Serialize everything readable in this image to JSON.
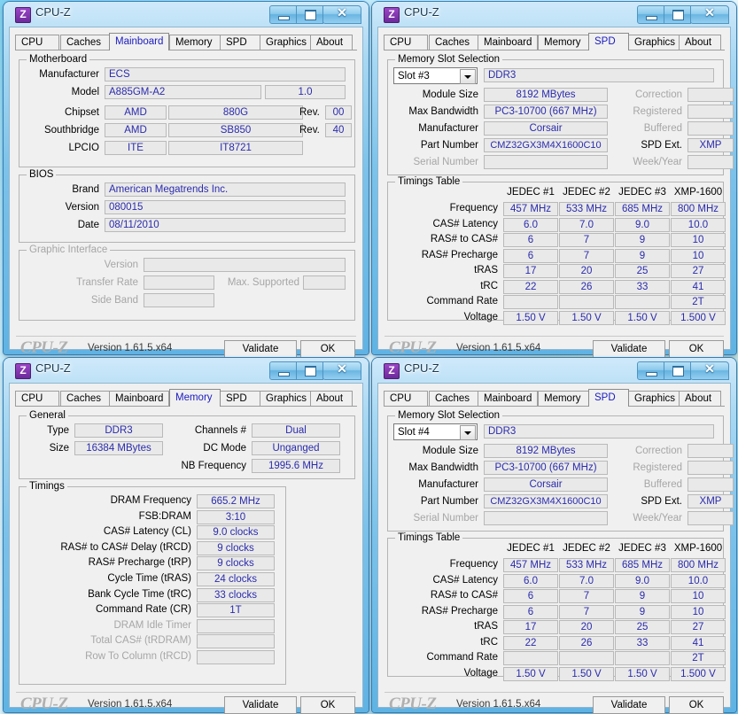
{
  "app": {
    "title": "CPU-Z",
    "icon": "cpuz-logo-icon",
    "logo_text": "CPU-Z",
    "version_text": "Version 1.61.5.x64",
    "validate_label": "Validate",
    "ok_label": "OK",
    "window_controls": {
      "minimize": "minimize-icon",
      "maximize": "maximize-icon",
      "close": "close-icon"
    }
  },
  "tabs": [
    "CPU",
    "Caches",
    "Mainboard",
    "Memory",
    "SPD",
    "Graphics",
    "About"
  ],
  "windows": {
    "mainboard": {
      "active_tab": "Mainboard",
      "motherboard": {
        "caption": "Motherboard",
        "manufacturer_label": "Manufacturer",
        "manufacturer_value": "ECS",
        "model_label": "Model",
        "model_value": "A885GM-A2",
        "model_rev_value": "1.0",
        "chipset_label": "Chipset",
        "chipset_vendor": "AMD",
        "chipset_model": "880G",
        "chipset_rev_label": "Rev.",
        "chipset_rev": "00",
        "southbridge_label": "Southbridge",
        "southbridge_vendor": "AMD",
        "southbridge_model": "SB850",
        "southbridge_rev_label": "Rev.",
        "southbridge_rev": "40",
        "lpcio_label": "LPCIO",
        "lpcio_vendor": "ITE",
        "lpcio_model": "IT8721"
      },
      "bios": {
        "caption": "BIOS",
        "brand_label": "Brand",
        "brand_value": "American Megatrends Inc.",
        "version_label": "Version",
        "version_value": "080015",
        "date_label": "Date",
        "date_value": "08/11/2010"
      },
      "graphic_interface": {
        "caption": "Graphic Interface",
        "version_label": "Version",
        "version_value": "",
        "transfer_rate_label": "Transfer Rate",
        "transfer_rate_value": "",
        "max_supported_label": "Max. Supported",
        "max_supported_value": "",
        "side_band_label": "Side Band",
        "side_band_value": ""
      }
    },
    "memory": {
      "active_tab": "Memory",
      "general": {
        "caption": "General",
        "type_label": "Type",
        "type_value": "DDR3",
        "size_label": "Size",
        "size_value": "16384 MBytes",
        "channels_label": "Channels #",
        "channels_value": "Dual",
        "dc_mode_label": "DC Mode",
        "dc_mode_value": "Unganged",
        "nb_frequency_label": "NB Frequency",
        "nb_frequency_value": "1995.6 MHz"
      },
      "timings": {
        "caption": "Timings",
        "rows": [
          {
            "label": "DRAM Frequency",
            "value": "665.2 MHz",
            "dim": false
          },
          {
            "label": "FSB:DRAM",
            "value": "3:10",
            "dim": false
          },
          {
            "label": "CAS# Latency (CL)",
            "value": "9.0 clocks",
            "dim": false
          },
          {
            "label": "RAS# to CAS# Delay (tRCD)",
            "value": "9 clocks",
            "dim": false
          },
          {
            "label": "RAS# Precharge (tRP)",
            "value": "9 clocks",
            "dim": false
          },
          {
            "label": "Cycle Time (tRAS)",
            "value": "24 clocks",
            "dim": false
          },
          {
            "label": "Bank Cycle Time (tRC)",
            "value": "33 clocks",
            "dim": false
          },
          {
            "label": "Command Rate (CR)",
            "value": "1T",
            "dim": false
          },
          {
            "label": "DRAM Idle Timer",
            "value": "",
            "dim": true
          },
          {
            "label": "Total CAS# (tRDRAM)",
            "value": "",
            "dim": true
          },
          {
            "label": "Row To Column (tRCD)",
            "value": "",
            "dim": true
          }
        ]
      }
    },
    "spd_slot3": {
      "active_tab": "SPD",
      "slot_selection": {
        "caption": "Memory Slot Selection",
        "slot_value": "Slot #3",
        "memory_type": "DDR3",
        "module_size_label": "Module Size",
        "module_size_value": "8192 MBytes",
        "max_bandwidth_label": "Max Bandwidth",
        "max_bandwidth_value": "PC3-10700 (667 MHz)",
        "manufacturer_label": "Manufacturer",
        "manufacturer_value": "Corsair",
        "part_number_label": "Part Number",
        "part_number_value": "CMZ32GX3M4X1600C10",
        "serial_number_label": "Serial Number",
        "serial_number_value": "",
        "correction_label": "Correction",
        "correction_value": "",
        "registered_label": "Registered",
        "registered_value": "",
        "buffered_label": "Buffered",
        "buffered_value": "",
        "spd_ext_label": "SPD Ext.",
        "spd_ext_value": "XMP",
        "week_year_label": "Week/Year",
        "week_year_value": ""
      },
      "timings_table": {
        "caption": "Timings Table",
        "columns": [
          "JEDEC #1",
          "JEDEC #2",
          "JEDEC #3",
          "XMP-1600"
        ],
        "rows": [
          {
            "label": "Frequency",
            "values": [
              "457 MHz",
              "533 MHz",
              "685 MHz",
              "800 MHz"
            ]
          },
          {
            "label": "CAS# Latency",
            "values": [
              "6.0",
              "7.0",
              "9.0",
              "10.0"
            ]
          },
          {
            "label": "RAS# to CAS#",
            "values": [
              "6",
              "7",
              "9",
              "10"
            ]
          },
          {
            "label": "RAS# Precharge",
            "values": [
              "6",
              "7",
              "9",
              "10"
            ]
          },
          {
            "label": "tRAS",
            "values": [
              "17",
              "20",
              "25",
              "27"
            ]
          },
          {
            "label": "tRC",
            "values": [
              "22",
              "26",
              "33",
              "41"
            ]
          },
          {
            "label": "Command Rate",
            "values": [
              "",
              "",
              "",
              "2T"
            ]
          },
          {
            "label": "Voltage",
            "values": [
              "1.50 V",
              "1.50 V",
              "1.50 V",
              "1.500 V"
            ]
          }
        ]
      }
    },
    "spd_slot4": {
      "active_tab": "SPD",
      "slot_selection": {
        "caption": "Memory Slot Selection",
        "slot_value": "Slot #4",
        "memory_type": "DDR3",
        "module_size_label": "Module Size",
        "module_size_value": "8192 MBytes",
        "max_bandwidth_label": "Max Bandwidth",
        "max_bandwidth_value": "PC3-10700 (667 MHz)",
        "manufacturer_label": "Manufacturer",
        "manufacturer_value": "Corsair",
        "part_number_label": "Part Number",
        "part_number_value": "CMZ32GX3M4X1600C10",
        "serial_number_label": "Serial Number",
        "serial_number_value": "",
        "correction_label": "Correction",
        "correction_value": "",
        "registered_label": "Registered",
        "registered_value": "",
        "buffered_label": "Buffered",
        "buffered_value": "",
        "spd_ext_label": "SPD Ext.",
        "spd_ext_value": "XMP",
        "week_year_label": "Week/Year",
        "week_year_value": ""
      },
      "timings_table": {
        "caption": "Timings Table",
        "columns": [
          "JEDEC #1",
          "JEDEC #2",
          "JEDEC #3",
          "XMP-1600"
        ],
        "rows": [
          {
            "label": "Frequency",
            "values": [
              "457 MHz",
              "533 MHz",
              "685 MHz",
              "800 MHz"
            ]
          },
          {
            "label": "CAS# Latency",
            "values": [
              "6.0",
              "7.0",
              "9.0",
              "10.0"
            ]
          },
          {
            "label": "RAS# to CAS#",
            "values": [
              "6",
              "7",
              "9",
              "10"
            ]
          },
          {
            "label": "RAS# Precharge",
            "values": [
              "6",
              "7",
              "9",
              "10"
            ]
          },
          {
            "label": "tRAS",
            "values": [
              "17",
              "20",
              "25",
              "27"
            ]
          },
          {
            "label": "tRC",
            "values": [
              "22",
              "26",
              "33",
              "41"
            ]
          },
          {
            "label": "Command Rate",
            "values": [
              "",
              "",
              "",
              "2T"
            ]
          },
          {
            "label": "Voltage",
            "values": [
              "1.50 V",
              "1.50 V",
              "1.50 V",
              "1.500 V"
            ]
          }
        ]
      }
    }
  },
  "colors": {
    "value_blue": "#2b2bad",
    "active_tab_text": "#1b1bbf",
    "dim_text": "#a6a6a6",
    "face": "#f0f0f0"
  }
}
